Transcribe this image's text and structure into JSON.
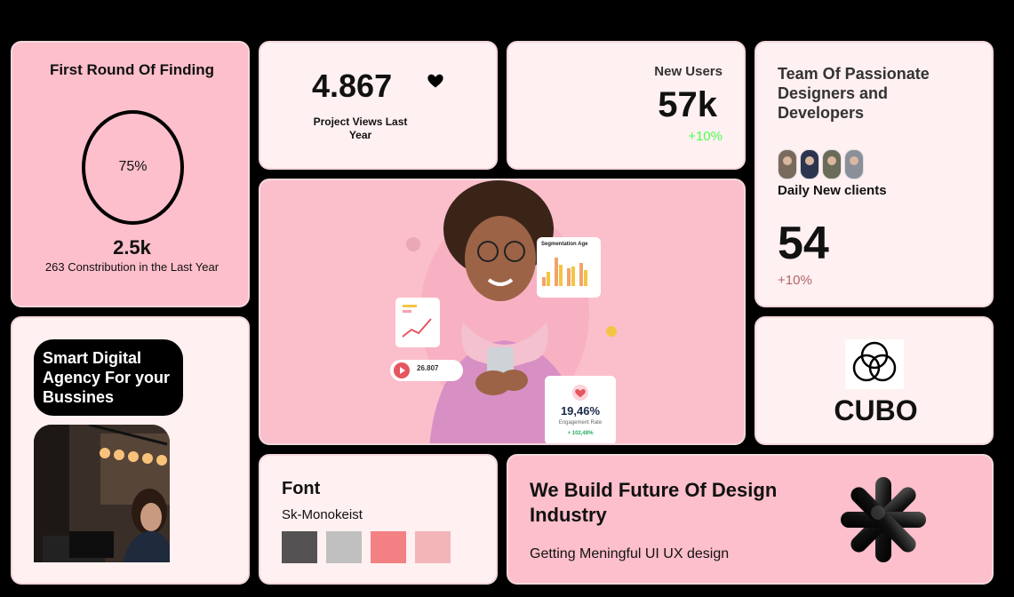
{
  "card_finding": {
    "title": "First Round Of Finding",
    "percent": "75%",
    "count": "2.5k",
    "caption": "263 Constribution in the Last Year"
  },
  "card_views": {
    "number": "4.867",
    "label": "Project Views Last Year",
    "icon": "heart-icon"
  },
  "card_users": {
    "title": "New Users",
    "number": "57k",
    "growth": "+10%",
    "growth_color": "#4cff4c"
  },
  "card_team": {
    "title": "Team Of Passionate Designers and Developers",
    "daily_label": "Daily New clients",
    "number": "54",
    "growth": "+10%"
  },
  "hero": {
    "chart_title": "Segmentation Age",
    "stat_value": "19,46%",
    "stat_label": "Engagement Rate",
    "stat_growth": "+ 102,48%",
    "player_value": "26.807"
  },
  "card_agency": {
    "title": "Smart Digital Agency For your Bussines"
  },
  "card_brand": {
    "name": "CUBO"
  },
  "card_font": {
    "title": "Font",
    "font_name": "Sk-Monokeist",
    "swatches": [
      "#555253",
      "#c0c0c0",
      "#f38083",
      "#f3b5b8"
    ]
  },
  "card_build": {
    "title": "We Build Future Of Design Industry",
    "subtitle": "Getting Meningful UI UX design"
  },
  "colors": {
    "pink": "#fdbfcb",
    "light": "#fff0f1",
    "background": "#000000"
  }
}
